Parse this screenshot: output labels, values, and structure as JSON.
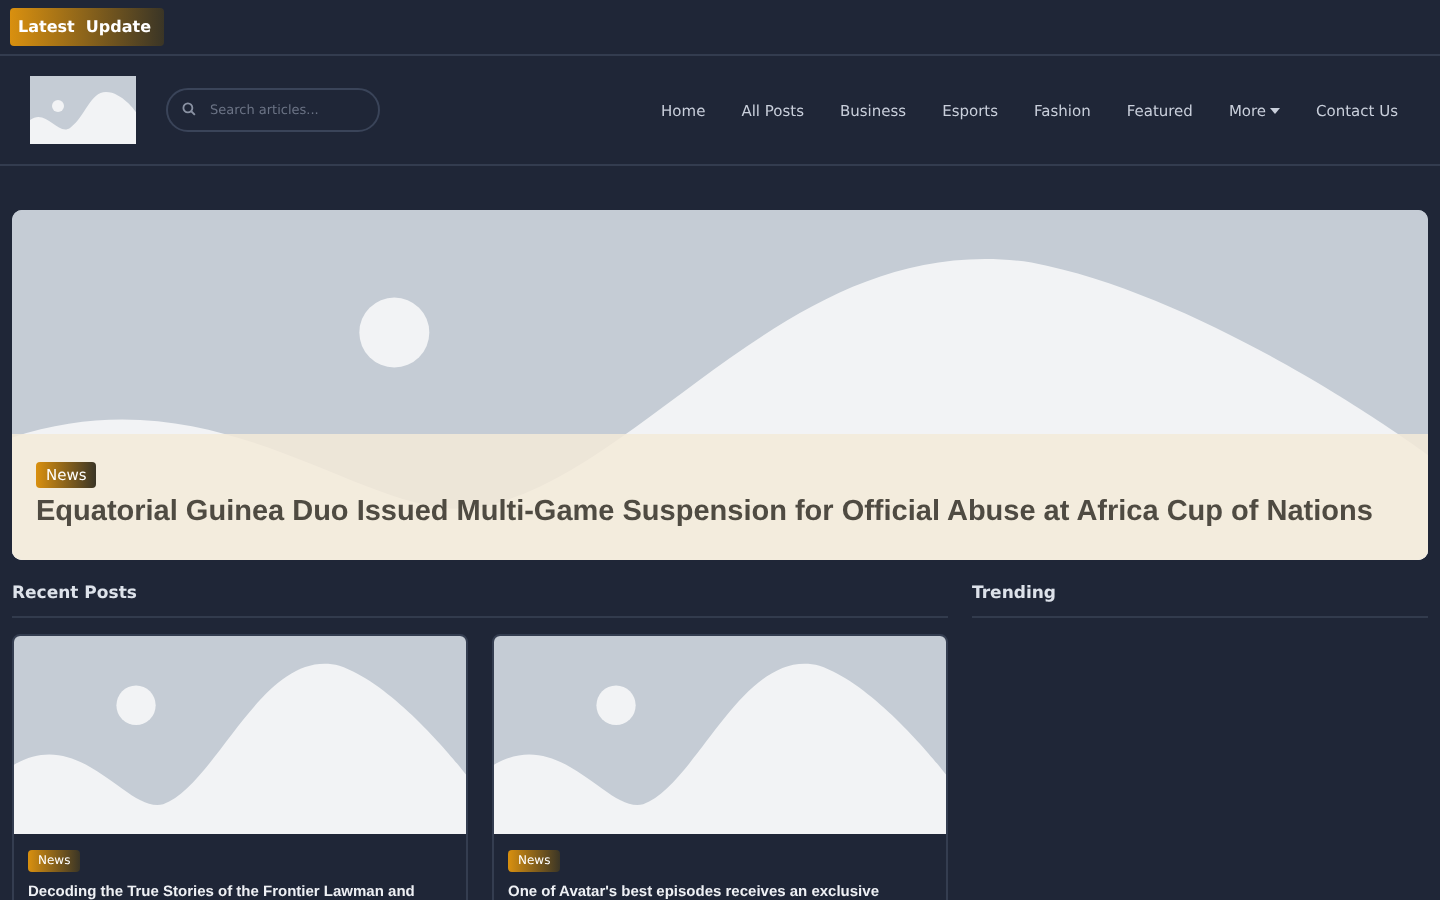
{
  "ticker": {
    "label": "Latest  Update"
  },
  "header": {
    "search": {
      "placeholder": "Search articles..."
    },
    "nav": [
      {
        "label": "Home",
        "kind": "link"
      },
      {
        "label": "All Posts",
        "kind": "link"
      },
      {
        "label": "Business",
        "kind": "link"
      },
      {
        "label": "Esports",
        "kind": "link"
      },
      {
        "label": "Fashion",
        "kind": "link"
      },
      {
        "label": "Featured",
        "kind": "link"
      },
      {
        "label": "More",
        "kind": "dropdown"
      },
      {
        "label": "Contact Us",
        "kind": "link"
      }
    ]
  },
  "hero": {
    "category": "News",
    "title": "Equatorial Guinea Duo Issued Multi-Game Suspension for Official Abuse at Africa Cup of Nations"
  },
  "recent": {
    "heading": "Recent Posts",
    "posts": [
      {
        "category": "News",
        "title": "Decoding the True Stories of the Frontier Lawman and"
      },
      {
        "category": "News",
        "title": "One of Avatar's best episodes receives an exclusive"
      }
    ]
  },
  "trending": {
    "heading": "Trending"
  }
}
